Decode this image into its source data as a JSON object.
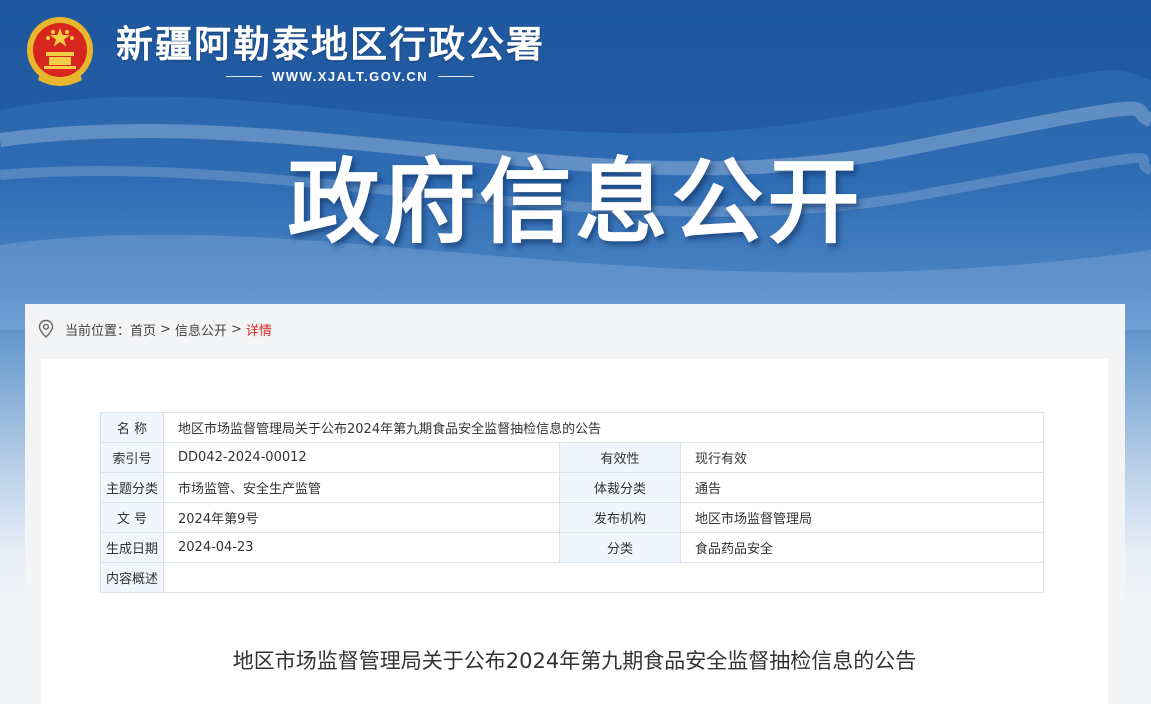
{
  "header": {
    "site_name": "新疆阿勒泰地区行政公署",
    "site_url": "WWW.XJALT.GOV.CN",
    "banner_title": "政府信息公开"
  },
  "breadcrumb": {
    "prefix": "当前位置：",
    "home": "首页",
    "section": "信息公开",
    "current": "详情",
    "separator": ">"
  },
  "meta_table": {
    "name_label": "名 称",
    "name_value": "地区市场监督管理局关于公布2024年第九期食品安全监督抽检信息的公告",
    "rows": [
      {
        "label": "索引号",
        "value": "DD042-2024-00012",
        "label2": "有效性",
        "value2": "现行有效"
      },
      {
        "label": "主题分类",
        "value": "市场监管、安全生产监管",
        "label2": "体裁分类",
        "value2": "通告"
      },
      {
        "label": "文 号",
        "value": "2024年第9号",
        "label2": "发布机构",
        "value2": "地区市场监督管理局"
      },
      {
        "label": "生成日期",
        "value": "2024-04-23",
        "label2": "分类",
        "value2": "食品药品安全"
      }
    ],
    "summary_label": "内容概述",
    "summary_value": ""
  },
  "article": {
    "title": "地区市场监督管理局关于公布2024年第九期食品安全监督抽检信息的公告"
  },
  "colors": {
    "banner_blue": "#2563a8",
    "breadcrumb_current": "#d9261c",
    "table_label_bg": "#f0f6fc",
    "table_border": "#dde3ea"
  },
  "icons": {
    "emblem": "national-emblem-icon",
    "location": "location-pin-icon"
  }
}
